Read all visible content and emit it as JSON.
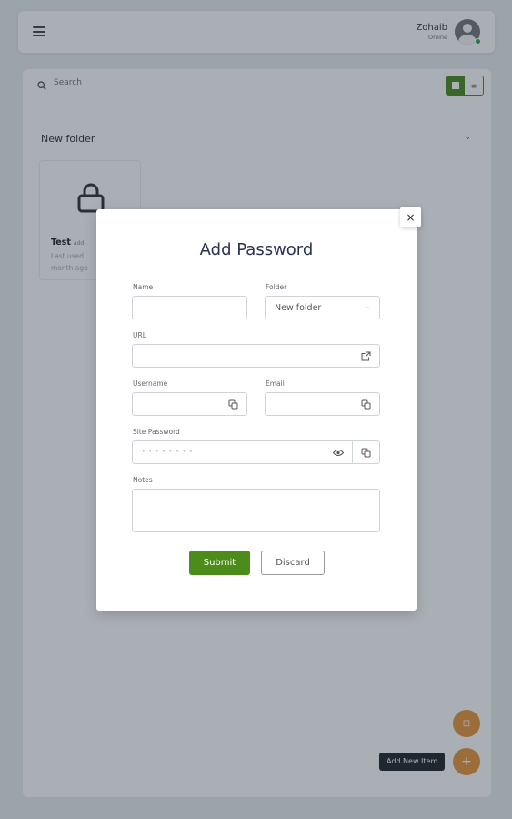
{
  "header": {
    "user_name": "Zohaib",
    "user_status": "Online"
  },
  "toolbar": {
    "search_placeholder": "Search"
  },
  "folder": {
    "title": "New folder",
    "items": [
      {
        "title": "Test",
        "badge": "add",
        "subtitle1": "Last used",
        "subtitle2": "month ago"
      }
    ]
  },
  "fab": {
    "tooltip": "Add New Item",
    "main_glyph": "+",
    "secondary_glyph": "⊡"
  },
  "modal": {
    "title": "Add Password",
    "close_glyph": "×",
    "fields": {
      "name": {
        "label": "Name",
        "value": ""
      },
      "folder": {
        "label": "Folder",
        "value": "New folder"
      },
      "url": {
        "label": "URL",
        "value": ""
      },
      "username": {
        "label": "Username",
        "value": ""
      },
      "email": {
        "label": "Email",
        "value": ""
      },
      "site_password": {
        "label": "Site Password",
        "masked": "• • • • • • • •"
      },
      "notes": {
        "label": "Notes",
        "value": ""
      }
    },
    "submit_label": "Submit",
    "discard_label": "Discard"
  },
  "colors": {
    "accent": "#4c8c1a",
    "fab": "#e8953a",
    "overlay": "rgba(30,45,60,0.38)",
    "title": "#2c3350"
  },
  "icons": {
    "menu": "hamburger-icon",
    "search": "search-icon",
    "external": "external-link-icon",
    "copy": "copy-icon",
    "eye": "eye-icon",
    "lock": "lock-icon",
    "close": "close-icon"
  }
}
